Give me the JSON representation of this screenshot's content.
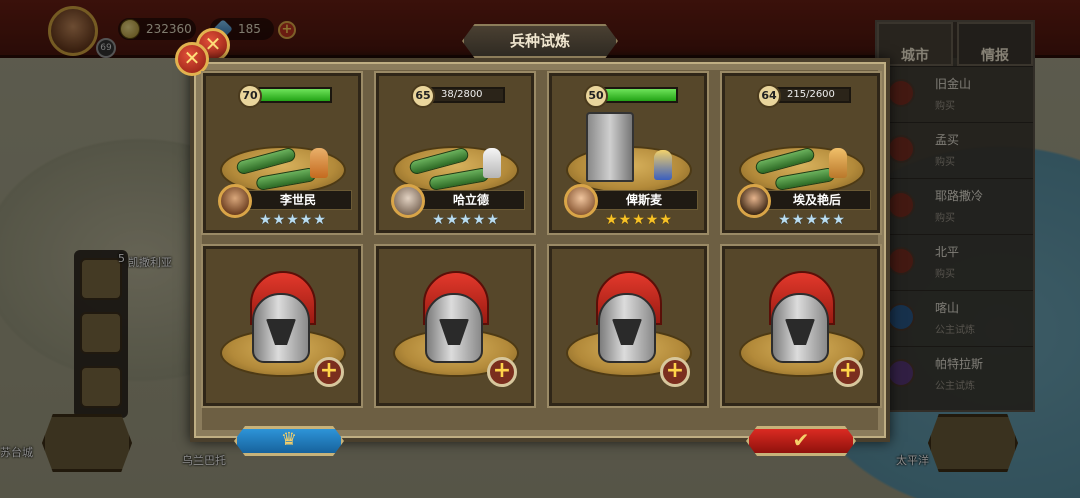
{
  "topbar": {
    "gold": "232360",
    "gems": "185",
    "player_level": "69"
  },
  "dialog": {
    "title": "兵种试炼",
    "close_icon": "close-icon",
    "left_button_icon": "crown-icon",
    "right_button_icon": "checkmark-icon"
  },
  "units": [
    {
      "level": "70",
      "progress_text": "",
      "progress": 1.0,
      "hero": "李世民",
      "stars": 5,
      "star_type": "silver",
      "unit": "cannon"
    },
    {
      "level": "65",
      "progress_text": "38/2800",
      "progress": 0.014,
      "hero": "哈立德",
      "stars": 5,
      "star_type": "silver",
      "unit": "cannon"
    },
    {
      "level": "50",
      "progress_text": "",
      "progress": 1.0,
      "hero": "俾斯麦",
      "stars": 5,
      "star_type": "gold",
      "unit": "siege-tower"
    },
    {
      "level": "64",
      "progress_text": "215/2600",
      "progress": 0.083,
      "hero": "埃及艳后",
      "stars": 5,
      "star_type": "silver",
      "unit": "cannon"
    }
  ],
  "empty_slots": [
    {
      "icon": "helmet-icon",
      "action_icon": "plus-icon"
    },
    {
      "icon": "helmet-icon",
      "action_icon": "plus-icon"
    },
    {
      "icon": "helmet-icon",
      "action_icon": "plus-icon"
    },
    {
      "icon": "helmet-icon",
      "action_icon": "plus-icon"
    }
  ],
  "city_panel": {
    "tabs": [
      "城市",
      "情报"
    ],
    "cities": [
      {
        "name": "旧金山",
        "status": "购买"
      },
      {
        "name": "孟买",
        "status": "购买"
      },
      {
        "name": "耶路撒冷",
        "status": "购买"
      },
      {
        "name": "北平",
        "status": "购买"
      },
      {
        "name": "喀山",
        "status": "公主试炼"
      },
      {
        "name": "帕特拉斯",
        "status": "公主试炼"
      }
    ]
  },
  "map_labels": {
    "city_a": "凯撒利亚",
    "city_b": "苏台城",
    "city_c": "乌兰巴托",
    "city_d": "太平洋",
    "badge": "5"
  },
  "colors": {
    "accent_red": "#d42b20",
    "accent_gold": "#d9a548",
    "bar_green": "#3fcf2c",
    "panel_brown": "#56472a"
  }
}
